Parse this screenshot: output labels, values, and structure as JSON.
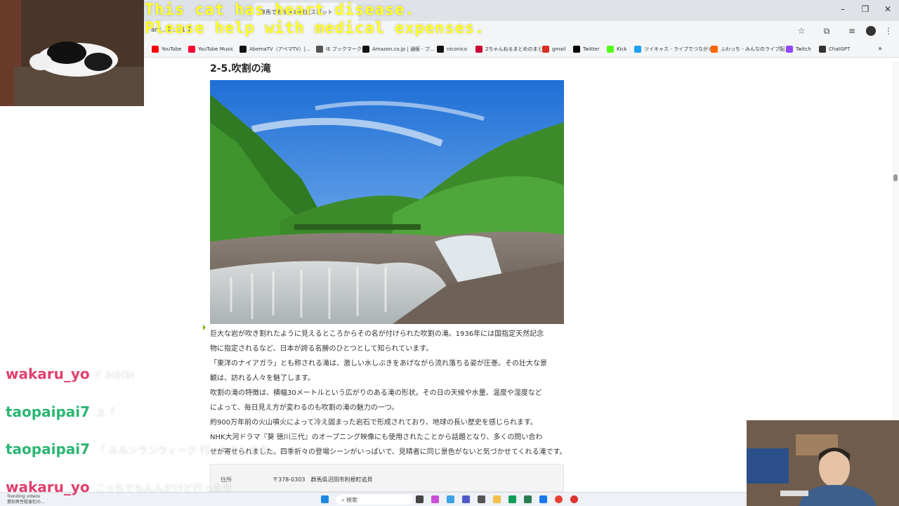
{
  "browser": {
    "tab_title": "群馬でおすすめ観光スポット",
    "address_fragment": "ark...2 ... 1 7",
    "bookmarks": [
      "YouTube",
      "YouTube Music",
      "AbemaTV（アベマTV）|...",
      "IE ブックマーク",
      "Amazon.co.jp | 通販 - ブ...",
      "niconico",
      "2ちゃんねるまとめのまとめ",
      "gmail",
      "Twitter",
      "Kick",
      "ツイキャス - ライブでつながる...",
      "ふわっち - みんなのライブ配...",
      "Twitch",
      "ChatGPT"
    ],
    "bookmark_colors": [
      "#ff0000",
      "#ff0033",
      "#111111",
      "#555555",
      "#111111",
      "#111111",
      "#cc0033",
      "#d93025",
      "#000000",
      "#53fc18",
      "#1da1f2",
      "#ff6600",
      "#9146ff",
      "#333333"
    ],
    "icons": [
      "star-icon",
      "extensions-icon",
      "media-icon",
      "more-icon",
      "minimize-icon",
      "maximize-icon",
      "close-icon",
      "chevron-right-icon"
    ]
  },
  "article": {
    "heading": "2-5.吹割の滝",
    "paragraphs": [
      "巨大な岩が吹き割れたように見えるところからその名が付けられた吹割の滝。1936年には国指定天然記念",
      "物に指定されるなど、日本が誇る名勝のひとつとして知られています。",
      "「東洋のナイアガラ」とも称される滝は、激しい水しぶきをあげながら流れ落ちる姿が圧巻。その壮大な景",
      "観は、訪れる人々を魅了します。",
      "吹割の滝の特徴は、横幅30メートルという広がりのある滝の形状。その日の天候や水量、温度や湿度など",
      "によって、毎日見え方が変わるのも吹割の滝の魅力の一つ。",
      "約900万年前の火山噴火によって冷え固まった岩石で形成されており、地球の長い歴史を感じられます。",
      "NHK大河ドラマ『葵 徳川三代』のオープニング映像にも使用されたことから話題となり、多くの問い合わ",
      "せが寄せられました。四季折々の登場シーンがいっぱいで、見晴者に同じ景色がないと気づかせてくれる滝です。"
    ],
    "info": {
      "label": "住所",
      "value": "〒378-0303　群馬県沼田市利根町追貝"
    }
  },
  "overlay": {
    "banner_line1": "This cat has heart disease.",
    "banner_line2": "Please help with medical expenses.",
    "chat": [
      {
        "user": "wakaru_yo",
        "color": "#e0406e",
        "message": "ﾃﾞｶｲｶｲｶｲ"
      },
      {
        "user": "taopaipai7",
        "color": "#2bb673",
        "message": "ス「"
      },
      {
        "user": "taopaipai7",
        "color": "#2bb673",
        "message": "「 ルルンランウィーク 行ったりしてる"
      },
      {
        "user": "wakaru_yo",
        "color": "#e0406e",
        "message": "こっちでもんんだけど行ったり"
      }
    ]
  },
  "taskbar": {
    "search_label": "検索",
    "trending_line1": "Trending videos",
    "trending_line2": "愛知男性殺害犯の..."
  }
}
